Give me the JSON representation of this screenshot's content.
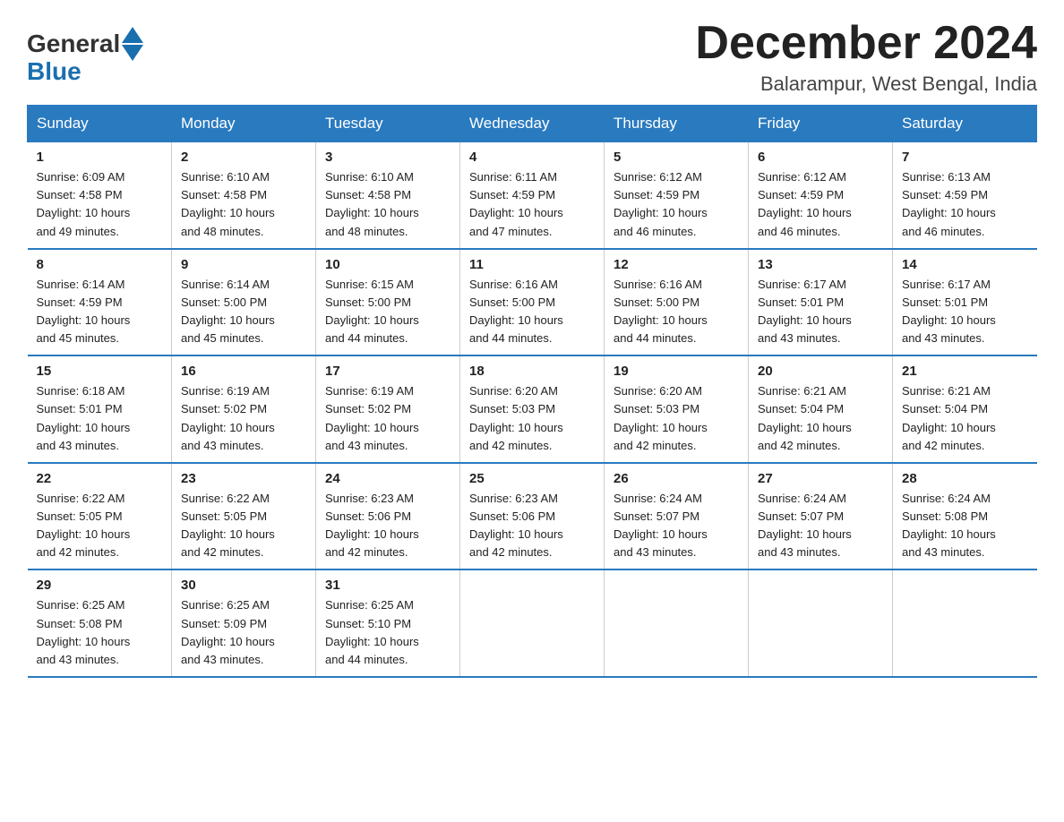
{
  "logo": {
    "general": "General",
    "blue": "Blue"
  },
  "header": {
    "month_year": "December 2024",
    "location": "Balarampur, West Bengal, India"
  },
  "weekdays": [
    "Sunday",
    "Monday",
    "Tuesday",
    "Wednesday",
    "Thursday",
    "Friday",
    "Saturday"
  ],
  "weeks": [
    [
      {
        "day": "1",
        "sunrise": "6:09 AM",
        "sunset": "4:58 PM",
        "daylight": "10 hours and 49 minutes."
      },
      {
        "day": "2",
        "sunrise": "6:10 AM",
        "sunset": "4:58 PM",
        "daylight": "10 hours and 48 minutes."
      },
      {
        "day": "3",
        "sunrise": "6:10 AM",
        "sunset": "4:58 PM",
        "daylight": "10 hours and 48 minutes."
      },
      {
        "day": "4",
        "sunrise": "6:11 AM",
        "sunset": "4:59 PM",
        "daylight": "10 hours and 47 minutes."
      },
      {
        "day": "5",
        "sunrise": "6:12 AM",
        "sunset": "4:59 PM",
        "daylight": "10 hours and 46 minutes."
      },
      {
        "day": "6",
        "sunrise": "6:12 AM",
        "sunset": "4:59 PM",
        "daylight": "10 hours and 46 minutes."
      },
      {
        "day": "7",
        "sunrise": "6:13 AM",
        "sunset": "4:59 PM",
        "daylight": "10 hours and 46 minutes."
      }
    ],
    [
      {
        "day": "8",
        "sunrise": "6:14 AM",
        "sunset": "4:59 PM",
        "daylight": "10 hours and 45 minutes."
      },
      {
        "day": "9",
        "sunrise": "6:14 AM",
        "sunset": "5:00 PM",
        "daylight": "10 hours and 45 minutes."
      },
      {
        "day": "10",
        "sunrise": "6:15 AM",
        "sunset": "5:00 PM",
        "daylight": "10 hours and 44 minutes."
      },
      {
        "day": "11",
        "sunrise": "6:16 AM",
        "sunset": "5:00 PM",
        "daylight": "10 hours and 44 minutes."
      },
      {
        "day": "12",
        "sunrise": "6:16 AM",
        "sunset": "5:00 PM",
        "daylight": "10 hours and 44 minutes."
      },
      {
        "day": "13",
        "sunrise": "6:17 AM",
        "sunset": "5:01 PM",
        "daylight": "10 hours and 43 minutes."
      },
      {
        "day": "14",
        "sunrise": "6:17 AM",
        "sunset": "5:01 PM",
        "daylight": "10 hours and 43 minutes."
      }
    ],
    [
      {
        "day": "15",
        "sunrise": "6:18 AM",
        "sunset": "5:01 PM",
        "daylight": "10 hours and 43 minutes."
      },
      {
        "day": "16",
        "sunrise": "6:19 AM",
        "sunset": "5:02 PM",
        "daylight": "10 hours and 43 minutes."
      },
      {
        "day": "17",
        "sunrise": "6:19 AM",
        "sunset": "5:02 PM",
        "daylight": "10 hours and 43 minutes."
      },
      {
        "day": "18",
        "sunrise": "6:20 AM",
        "sunset": "5:03 PM",
        "daylight": "10 hours and 42 minutes."
      },
      {
        "day": "19",
        "sunrise": "6:20 AM",
        "sunset": "5:03 PM",
        "daylight": "10 hours and 42 minutes."
      },
      {
        "day": "20",
        "sunrise": "6:21 AM",
        "sunset": "5:04 PM",
        "daylight": "10 hours and 42 minutes."
      },
      {
        "day": "21",
        "sunrise": "6:21 AM",
        "sunset": "5:04 PM",
        "daylight": "10 hours and 42 minutes."
      }
    ],
    [
      {
        "day": "22",
        "sunrise": "6:22 AM",
        "sunset": "5:05 PM",
        "daylight": "10 hours and 42 minutes."
      },
      {
        "day": "23",
        "sunrise": "6:22 AM",
        "sunset": "5:05 PM",
        "daylight": "10 hours and 42 minutes."
      },
      {
        "day": "24",
        "sunrise": "6:23 AM",
        "sunset": "5:06 PM",
        "daylight": "10 hours and 42 minutes."
      },
      {
        "day": "25",
        "sunrise": "6:23 AM",
        "sunset": "5:06 PM",
        "daylight": "10 hours and 42 minutes."
      },
      {
        "day": "26",
        "sunrise": "6:24 AM",
        "sunset": "5:07 PM",
        "daylight": "10 hours and 43 minutes."
      },
      {
        "day": "27",
        "sunrise": "6:24 AM",
        "sunset": "5:07 PM",
        "daylight": "10 hours and 43 minutes."
      },
      {
        "day": "28",
        "sunrise": "6:24 AM",
        "sunset": "5:08 PM",
        "daylight": "10 hours and 43 minutes."
      }
    ],
    [
      {
        "day": "29",
        "sunrise": "6:25 AM",
        "sunset": "5:08 PM",
        "daylight": "10 hours and 43 minutes."
      },
      {
        "day": "30",
        "sunrise": "6:25 AM",
        "sunset": "5:09 PM",
        "daylight": "10 hours and 43 minutes."
      },
      {
        "day": "31",
        "sunrise": "6:25 AM",
        "sunset": "5:10 PM",
        "daylight": "10 hours and 44 minutes."
      },
      null,
      null,
      null,
      null
    ]
  ],
  "labels": {
    "sunrise": "Sunrise:",
    "sunset": "Sunset:",
    "daylight": "Daylight:"
  }
}
